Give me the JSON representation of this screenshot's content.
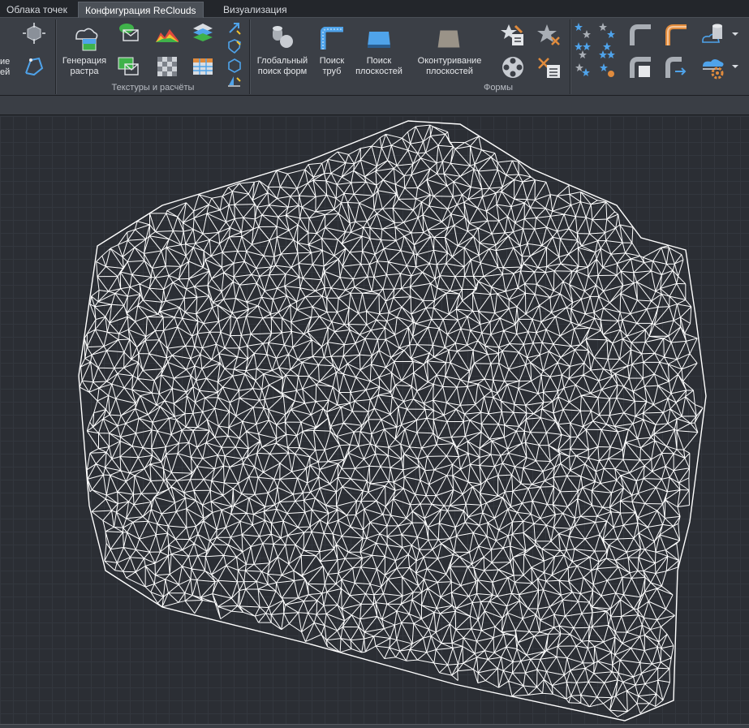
{
  "tabs": [
    {
      "label": "Облака точек",
      "active": false
    },
    {
      "label": "Конфигурация ReClouds",
      "active": true
    },
    {
      "label": "Визуализация",
      "active": false
    }
  ],
  "ribbon": {
    "left_partial": {
      "line1": "ие",
      "line2": "ей"
    },
    "textures": {
      "group_label": "Текстуры и расчёты",
      "raster_label_1": "Генерация",
      "raster_label_2": "растра"
    },
    "shapes": {
      "group_label": "Формы",
      "global_search_1": "Глобальный",
      "global_search_2": "поиск форм",
      "pipe_search_1": "Поиск",
      "pipe_search_2": "труб",
      "plane_search_1": "Поиск",
      "plane_search_2": "плоскостей",
      "contour_1": "Оконтуривание",
      "contour_2": "плоскостей"
    }
  },
  "colors": {
    "mesh": "#ffffff",
    "viewport_bg": "#2b2e34",
    "accent_blue": "#3d8fe0",
    "accent_green": "#3fb24a",
    "accent_orange": "#e08b3d"
  }
}
